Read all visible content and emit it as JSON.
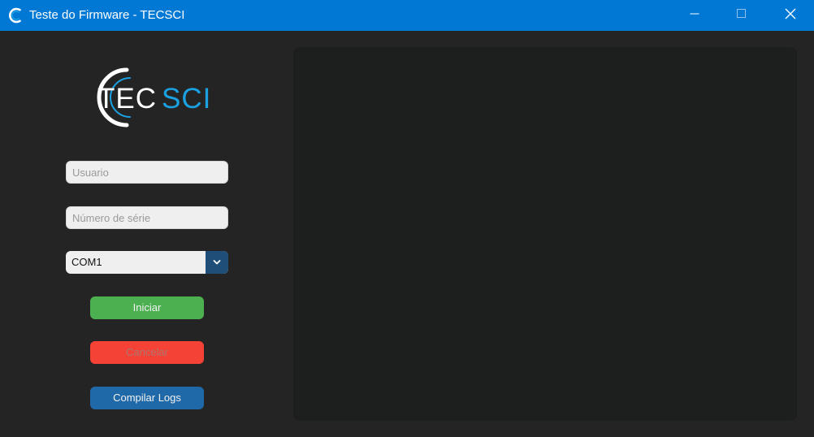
{
  "window": {
    "title": "Teste do Firmware - TECSCI",
    "app_icon": "app-ring-icon",
    "controls": {
      "minimize_icon": "minimize-icon",
      "maximize_icon": "maximize-icon",
      "close_icon": "close-icon"
    },
    "colors": {
      "titlebar": "#0078d4",
      "background": "#242424"
    }
  },
  "logo": {
    "brand_left": "TEC",
    "brand_right": "SCI",
    "colors": {
      "accent": "#1ba1e2",
      "white": "#ffffff"
    }
  },
  "form": {
    "user": {
      "value": "",
      "placeholder": "Usuario"
    },
    "serial": {
      "value": "",
      "placeholder": "Número de série"
    },
    "port": {
      "selected": "COM1",
      "arrow_icon": "chevron-down-icon"
    }
  },
  "buttons": {
    "start": {
      "label": "Iniciar",
      "color": "#4caf50"
    },
    "cancel": {
      "label": "Cancelar",
      "color": "#f44336"
    },
    "logs": {
      "label": "Compilar Logs",
      "color": "#1f69a8"
    }
  },
  "log_panel": {
    "content": ""
  }
}
